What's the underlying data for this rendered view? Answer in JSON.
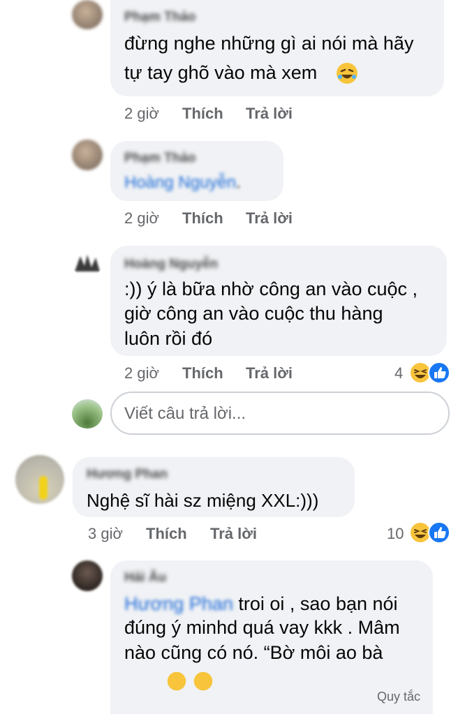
{
  "comments": [
    {
      "name": "Phạm Thảo",
      "text_lines": [
        "đừng nghe những gì ai nói mà hãy",
        "tự tay ghõ vào mà xem"
      ],
      "time": "2 giờ",
      "like_label": "Thích",
      "reply_label": "Trả lời",
      "emoji": "rolling-on-floor-laughing"
    },
    {
      "name": "Phạm Thảo",
      "mention": "Hoàng Nguyễn",
      "mention_suffix": ".",
      "time": "2 giờ",
      "like_label": "Thích",
      "reply_label": "Trả lời"
    },
    {
      "name": "Hoàng Nguyễn",
      "text_lines": [
        ":)) ý là bữa nhờ công an vào cuộc ,",
        "giờ công an vào cuộc thu hàng",
        "luôn rồi đó"
      ],
      "time": "2 giờ",
      "like_label": "Thích",
      "reply_label": "Trả lời",
      "reaction_count": "4"
    },
    {
      "name": "Hương Phan",
      "text_lines": [
        "Nghệ sĩ hài sz miệng XXL:)))"
      ],
      "time": "3 giờ",
      "like_label": "Thích",
      "reply_label": "Trả lời",
      "reaction_count": "10"
    },
    {
      "name": "Hải Âu",
      "mention": "Hương Phan",
      "text_lines": [
        " troi oi , sao bạn nói",
        "đúng ý minhd quá vay kkk . Mâm",
        "nào cũng có nó. “Bờ môi ao bà"
      ]
    }
  ],
  "reply_box": {
    "placeholder": "Viết câu trả lời..."
  },
  "footer": {
    "partial_link": "Quy tắc"
  },
  "colors": {
    "bubble": "#f0f2f5",
    "meta": "#65676b",
    "mention": "#1c6ad6",
    "like_blue": "#1877f2",
    "haha_yellow": "#f7c43c"
  }
}
